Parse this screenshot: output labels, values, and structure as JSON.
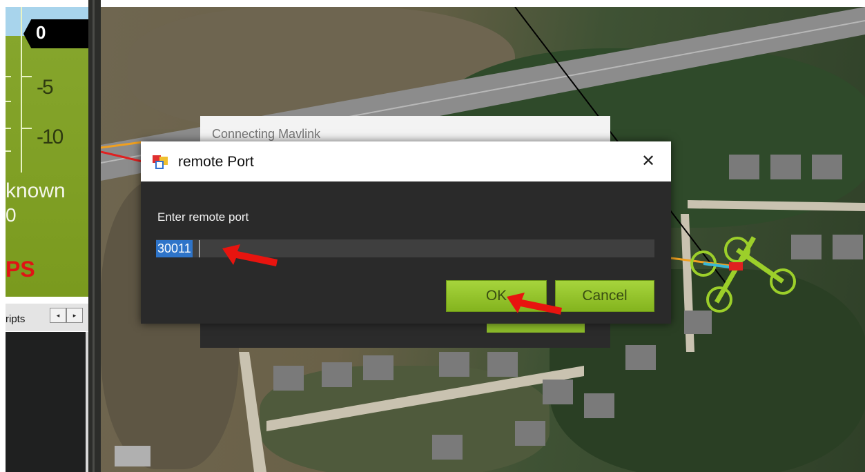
{
  "hud": {
    "altitude_value": "0",
    "scale_labels": [
      "-5",
      "-10"
    ],
    "status_text": "known",
    "status_value": "0",
    "gps_text": "PS"
  },
  "left_tabs": {
    "tab_label": "ripts",
    "scroll_left_icon": "◂",
    "scroll_right_icon": "▸"
  },
  "background_dialog": {
    "title": "Connecting Mavlink"
  },
  "dialog": {
    "title": "remote Port",
    "close_icon": "✕",
    "prompt": "Enter remote port",
    "input_value": "30011",
    "ok_label": "OK",
    "cancel_label": "Cancel"
  },
  "colors": {
    "accent_green": "#8cbb2a",
    "annotation_red": "#e8140f",
    "selection_blue": "#2e74c9"
  }
}
